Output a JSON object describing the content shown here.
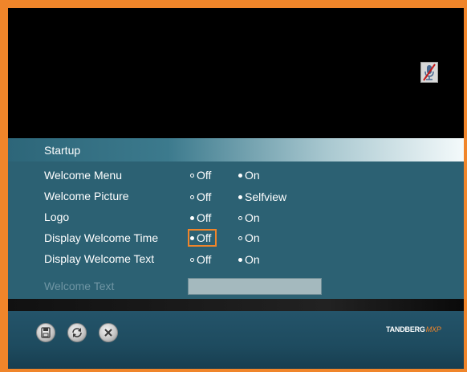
{
  "menu": {
    "title": "Startup",
    "rows": [
      {
        "label": "Welcome Menu",
        "option1": "Off",
        "option2": "On",
        "selected": "option2"
      },
      {
        "label": "Welcome Picture",
        "option1": "Off",
        "option2": "Selfview",
        "selected": "option2"
      },
      {
        "label": "Logo",
        "option1": "Off",
        "option2": "On",
        "selected": "option1"
      },
      {
        "label": "Display Welcome Time",
        "option1": "Off",
        "option2": "On",
        "selected": "option1",
        "focused": true
      },
      {
        "label": "Display Welcome Text",
        "option1": "Off",
        "option2": "On",
        "selected": "option2"
      }
    ],
    "welcome_text": {
      "label": "Welcome Text",
      "value": ""
    }
  },
  "status": {
    "mic_icon": "microphone-muted-icon"
  },
  "toolbar": {
    "buttons": [
      {
        "name": "save-button",
        "icon": "floppy-disk-icon"
      },
      {
        "name": "refresh-button",
        "icon": "refresh-icon"
      },
      {
        "name": "close-button",
        "icon": "close-icon"
      }
    ]
  },
  "branding": {
    "name": "TANDBERG",
    "suffix": "MXP"
  },
  "colors": {
    "frame": "#f0852a",
    "panel": "#2c6173",
    "focus": "#f0852a",
    "disabled_text": "#6f95a3"
  }
}
